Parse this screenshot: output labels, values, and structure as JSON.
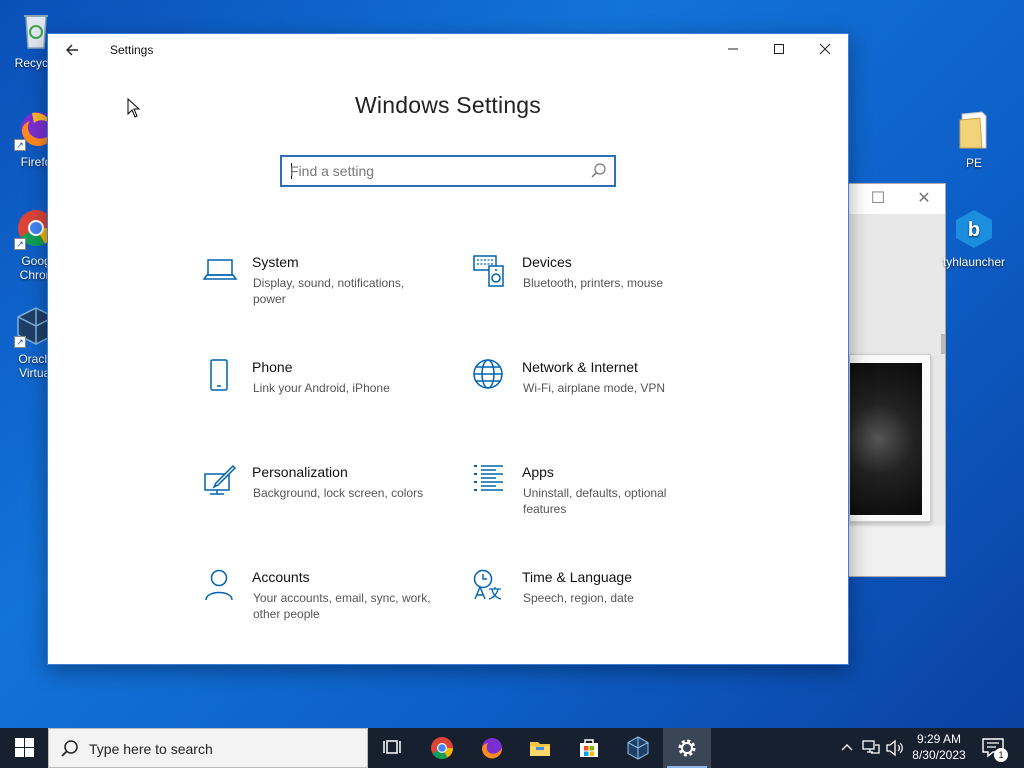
{
  "desktop": {
    "icons_left": [
      {
        "label": "Recycle",
        "icon": "recycle-bin-icon"
      },
      {
        "label": "Firefo",
        "icon": "firefox-icon"
      },
      {
        "label": "Goog",
        "label2": "Chron",
        "icon": "chrome-icon"
      },
      {
        "label": "Oracle",
        "label2": "Virtual",
        "icon": "virtualbox-icon"
      }
    ],
    "icons_right": [
      {
        "label": "PE",
        "icon": "folder-icon"
      },
      {
        "label": "tyhlauncher",
        "icon": "launcher-icon"
      }
    ]
  },
  "settings": {
    "window_title": "Settings",
    "back_icon": "back-arrow-icon",
    "heading": "Windows Settings",
    "search_placeholder": "Find a setting",
    "accent": "#0063b1",
    "tiles": [
      {
        "title": "System",
        "desc": "Display, sound, notifications, power",
        "icon": "laptop-icon"
      },
      {
        "title": "Devices",
        "desc": "Bluetooth, printers, mouse",
        "icon": "devices-icon"
      },
      {
        "title": "Phone",
        "desc": "Link your Android, iPhone",
        "icon": "phone-icon"
      },
      {
        "title": "Network & Internet",
        "desc": "Wi-Fi, airplane mode, VPN",
        "icon": "globe-icon"
      },
      {
        "title": "Personalization",
        "desc": "Background, lock screen, colors",
        "icon": "paint-icon"
      },
      {
        "title": "Apps",
        "desc": "Uninstall, defaults, optional features",
        "icon": "apps-list-icon"
      },
      {
        "title": "Accounts",
        "desc": "Your accounts, email, sync, work, other people",
        "icon": "person-icon"
      },
      {
        "title": "Time & Language",
        "desc": "Speech, region, date",
        "icon": "time-language-icon"
      }
    ]
  },
  "taskbar": {
    "search_text": "Type here to search",
    "time": "9:29 AM",
    "date": "8/30/2023",
    "notification_count": "1",
    "background": "#16202e"
  }
}
